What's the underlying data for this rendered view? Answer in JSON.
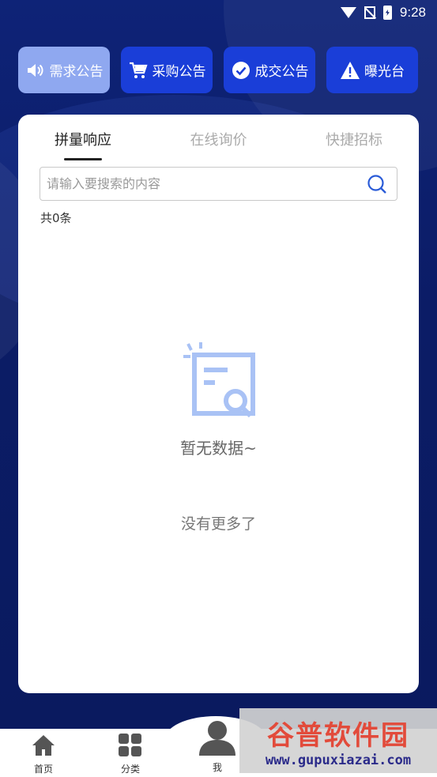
{
  "status": {
    "time": "9:28"
  },
  "topnav": [
    {
      "label": "需求公告",
      "icon": "speaker-icon",
      "active": true
    },
    {
      "label": "采购公告",
      "icon": "cart-icon",
      "active": false
    },
    {
      "label": "成交公告",
      "icon": "check-circle-icon",
      "active": false
    },
    {
      "label": "曝光台",
      "icon": "warning-icon",
      "active": false
    }
  ],
  "tabs": [
    {
      "label": "拼量响应",
      "active": true
    },
    {
      "label": "在线询价",
      "active": false
    },
    {
      "label": "快捷招标",
      "active": false
    }
  ],
  "search": {
    "placeholder": "请输入要搜索的内容",
    "value": ""
  },
  "list": {
    "count_text": "共0条",
    "empty_text": "暂无数据~",
    "no_more_text": "没有更多了"
  },
  "bottom_nav": [
    {
      "label": "首页",
      "icon": "home-icon"
    },
    {
      "label": "分类",
      "icon": "grid-icon"
    },
    {
      "label": "我",
      "icon": "user-icon"
    }
  ],
  "watermark": {
    "title": "谷普软件园",
    "url": "www.gupuxiazai.com"
  },
  "colors": {
    "primary": "#1a3ed8",
    "active_btn": "#8fa8f0",
    "background": "#0e2377"
  }
}
